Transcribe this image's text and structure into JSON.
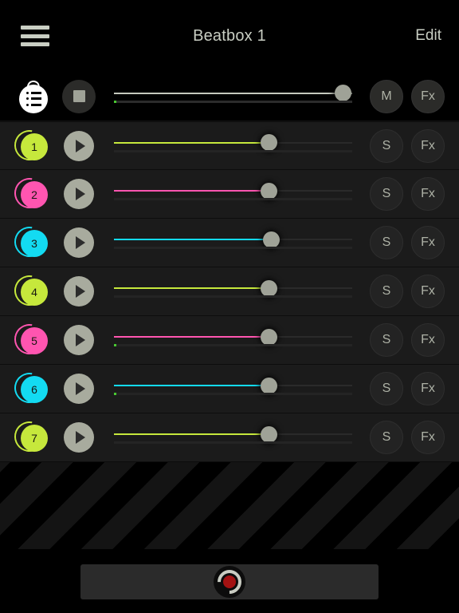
{
  "header": {
    "menu_icon": "hamburger-menu-icon",
    "title": "Beatbox 1",
    "edit_label": "Edit"
  },
  "master": {
    "song_icon": "song-list-icon",
    "stop_icon": "stop-icon",
    "mute_label": "M",
    "fx_label": "Fx",
    "slider": {
      "value": 96,
      "meter": 1
    }
  },
  "colors": {
    "green": "#c6e83c",
    "pink": "#ff55b0",
    "cyan": "#13dbf2",
    "thumb": "#9fa297",
    "play": "#a8ab9e",
    "text": "#c9cec3",
    "record": "#a31212"
  },
  "tracks": [
    {
      "number": "1",
      "color": "#c6e83c",
      "solo_label": "S",
      "fx_label": "Fx",
      "volume": 65,
      "meter": 0
    },
    {
      "number": "2",
      "color": "#ff55b0",
      "solo_label": "S",
      "fx_label": "Fx",
      "volume": 65,
      "meter": 0
    },
    {
      "number": "3",
      "color": "#13dbf2",
      "solo_label": "S",
      "fx_label": "Fx",
      "volume": 66,
      "meter": 0
    },
    {
      "number": "4",
      "color": "#c6e83c",
      "solo_label": "S",
      "fx_label": "Fx",
      "volume": 65,
      "meter": 0
    },
    {
      "number": "5",
      "color": "#ff55b0",
      "solo_label": "S",
      "fx_label": "Fx",
      "volume": 65,
      "meter": 1
    },
    {
      "number": "6",
      "color": "#13dbf2",
      "solo_label": "S",
      "fx_label": "Fx",
      "volume": 65,
      "meter": 1
    },
    {
      "number": "7",
      "color": "#c6e83c",
      "solo_label": "S",
      "fx_label": "Fx",
      "volume": 65,
      "meter": 0
    }
  ],
  "footer": {
    "record_icon": "record-icon"
  }
}
